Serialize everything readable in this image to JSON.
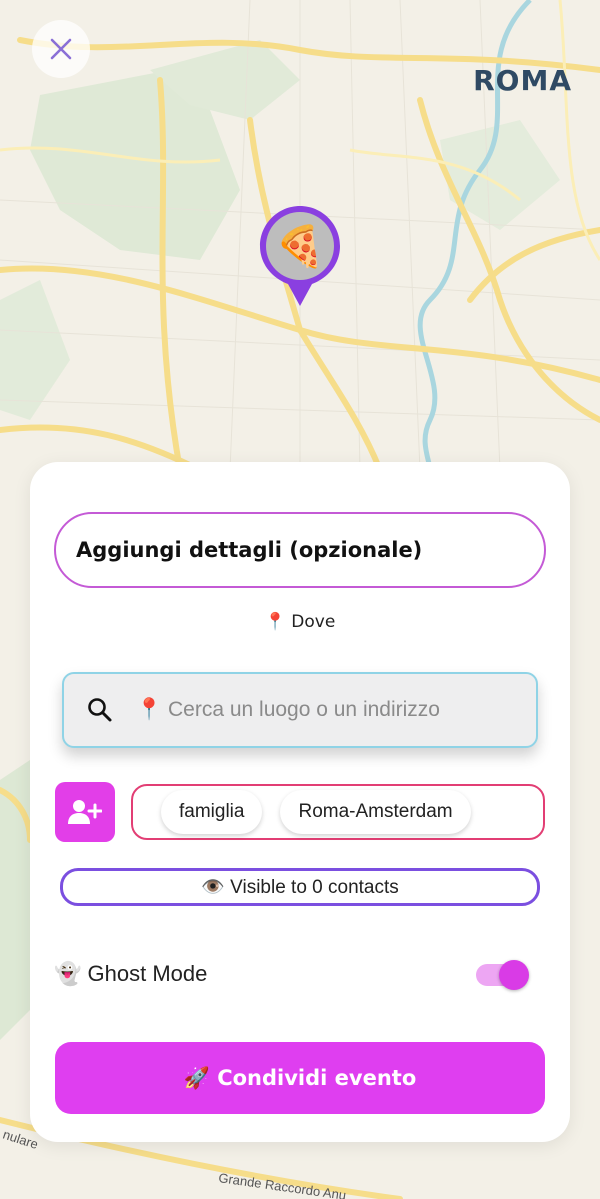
{
  "map": {
    "city_label": "ROMA",
    "road_labels": [
      "nulare",
      "Grande Raccordo Anu"
    ],
    "pin_emoji": "🍕",
    "close_icon": "close-icon"
  },
  "form": {
    "title_placeholder": "Aggiungi dettagli (opzionale)",
    "where_label": "📍 Dove",
    "search_icon": "search-icon",
    "search_placeholder": "📍 Cerca un luogo o un indirizzo",
    "add_contact_icon": "add-person-icon",
    "groups": [
      "famiglia",
      "Roma-Amsterdam"
    ],
    "visibility_text": "👁️ Visible to 0 contacts",
    "ghost_mode_label": "👻 Ghost Mode",
    "ghost_mode_on": true,
    "share_button_label": "🚀 Condividi evento"
  },
  "colors": {
    "accent": "#df3ef0",
    "title_border": "#c45ad6",
    "search_border": "#8fd3e6",
    "groups_border": "#e23e74",
    "visibility_border": "#7b4fe0",
    "pin_ring": "#8a3fe0"
  }
}
